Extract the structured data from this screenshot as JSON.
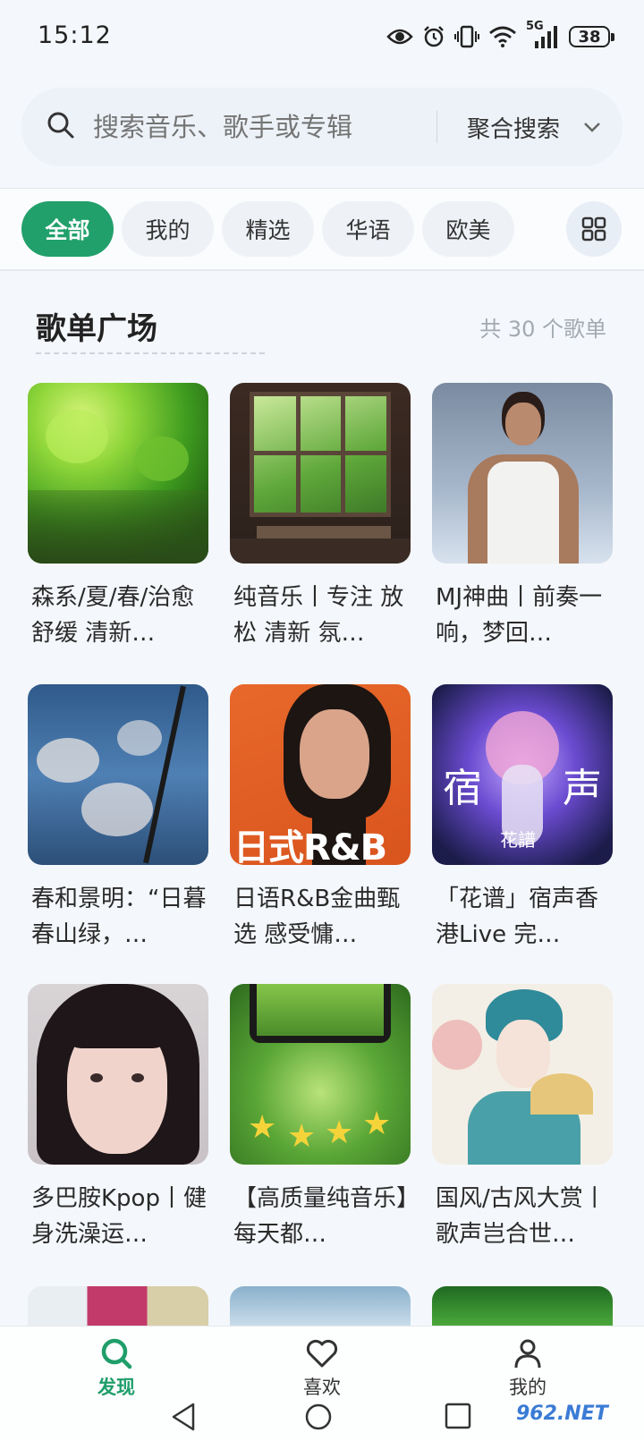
{
  "status_bar": {
    "time": "15:12",
    "network": "5G",
    "battery": "38"
  },
  "search": {
    "placeholder": "搜索音乐、歌手或专辑",
    "mode": "聚合搜索"
  },
  "tabs": [
    {
      "label": "全部",
      "active": true
    },
    {
      "label": "我的",
      "active": false
    },
    {
      "label": "精选",
      "active": false
    },
    {
      "label": "华语",
      "active": false
    },
    {
      "label": "欧美",
      "active": false
    }
  ],
  "section": {
    "title": "歌单广场",
    "count": "共 30 个歌单"
  },
  "playlists": [
    {
      "title": "森系/夏/春/治愈 舒缓 清新…",
      "cover": "green-forest"
    },
    {
      "title": "纯音乐丨专注 放松 清新 氛…",
      "cover": "classroom-window"
    },
    {
      "title": "MJ神曲丨前奏一响，梦回…",
      "cover": "singer-white-tank"
    },
    {
      "title": "春和景明：“日暮春山绿，…",
      "cover": "cherry-blossom-sky"
    },
    {
      "title": "日语R&B金曲甄选 感受慵…",
      "cover": "orange-portrait",
      "cover_text": "日式R&B"
    },
    {
      "title": "「花谱」宿声香港Live 完…",
      "cover": "anime-flower",
      "cover_text": [
        "宿",
        "声",
        "花譜"
      ]
    },
    {
      "title": "多巴胺Kpop丨健身洗澡运…",
      "cover": "girl-portrait"
    },
    {
      "title": "【高质量纯音乐】每天都…",
      "cover": "star-lights"
    },
    {
      "title": "国风/古风大赏丨歌声岂合世…",
      "cover": "opera-illustration"
    }
  ],
  "bottom_nav": [
    {
      "label": "发现",
      "icon": "search-icon",
      "active": true
    },
    {
      "label": "喜欢",
      "icon": "heart-icon",
      "active": false
    },
    {
      "label": "我的",
      "icon": "person-icon",
      "active": false
    }
  ],
  "watermark": "962.NET",
  "colors": {
    "accent": "#22a06b",
    "background": "#f4f7fb",
    "muted_text": "#a3a9b0"
  }
}
